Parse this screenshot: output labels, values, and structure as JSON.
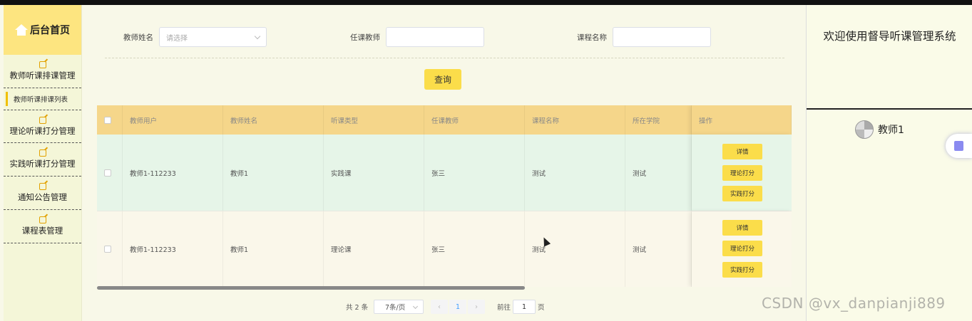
{
  "sidebar": {
    "title": "后台首页",
    "items": [
      {
        "label": "教师听课排课管理"
      },
      {
        "label": "理论听课打分管理"
      },
      {
        "label": "实践听课打分管理"
      },
      {
        "label": "通知公告管理"
      },
      {
        "label": "课程表管理"
      }
    ],
    "submenu": "教师听课排课列表"
  },
  "search": {
    "teacher_label": "教师姓名",
    "teacher_placeholder": "请选择",
    "lecturer_label": "任课教师",
    "lecturer_value": "",
    "course_label": "课程名称",
    "course_value": "",
    "query_button": "查询"
  },
  "table": {
    "headers": [
      "教师用户",
      "教师姓名",
      "听课类型",
      "任课教师",
      "课程名称",
      "所在学院",
      "操作"
    ],
    "rows": [
      {
        "user": "教师1-112233",
        "name": "教师1",
        "type": "实践课",
        "lecturer": "张三",
        "course": "测试",
        "college": "测试"
      },
      {
        "user": "教师1-112233",
        "name": "教师1",
        "type": "理论课",
        "lecturer": "张三",
        "course": "测试",
        "college": "测试"
      }
    ],
    "actions": [
      "详情",
      "理论打分",
      "实践打分"
    ]
  },
  "pagination": {
    "total": "共 2 条",
    "page_size": "7条/页",
    "prev": "‹",
    "current": "1",
    "next": "›",
    "goto_label": "前往",
    "goto_value": "1",
    "page_suffix": "页"
  },
  "right_panel": {
    "welcome": "欢迎使用督导听课管理系统",
    "username": "教师1"
  },
  "watermark": "CSDN @vx_danpianji889",
  "colors": {
    "accent": "#fbdd4a",
    "header_bg": "#f5d68a",
    "row1_bg": "#e6f5e8",
    "row2_bg": "#faf7ea"
  }
}
